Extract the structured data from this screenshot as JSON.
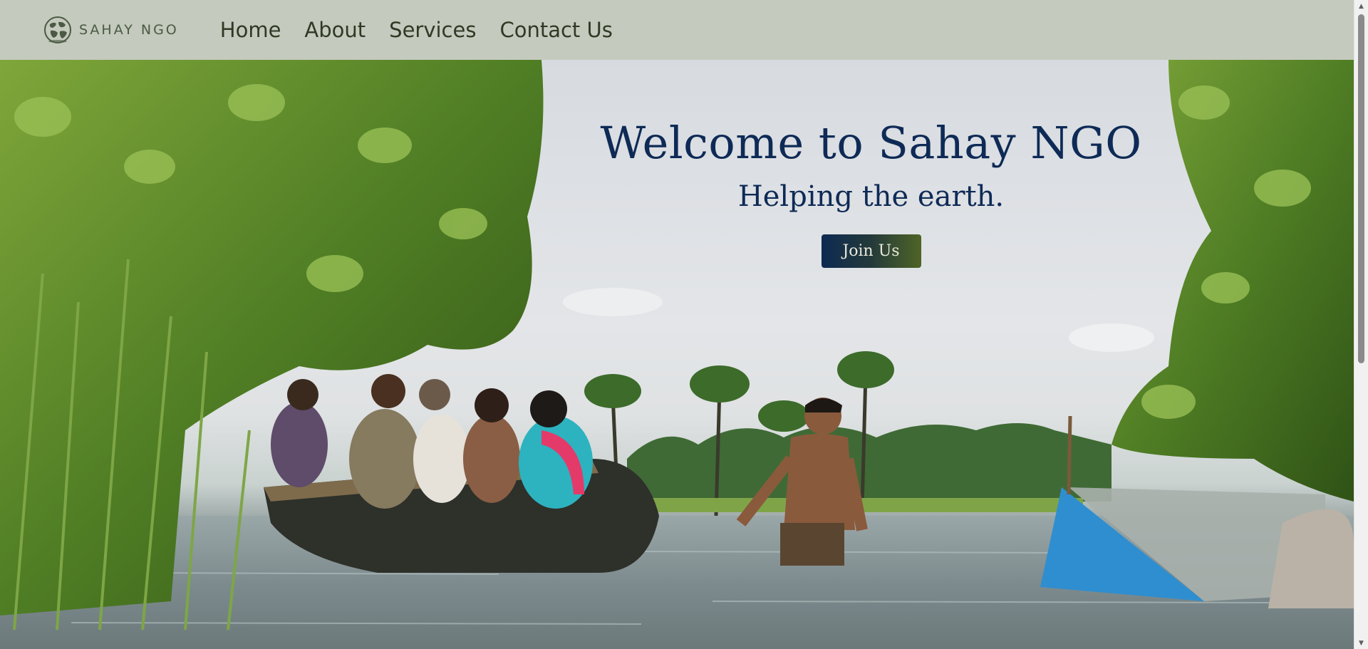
{
  "nav": {
    "brand": "SAHAY NGO",
    "links": [
      "Home",
      "About",
      "Services",
      "Contact Us"
    ]
  },
  "hero": {
    "title": "Welcome to Sahay NGO",
    "subtitle": "Helping the earth.",
    "cta": "Join Us"
  },
  "colors": {
    "navbar_bg": "#c4cabe",
    "title_color": "#0e2a56",
    "button_gradient_start": "#0d2a52",
    "button_gradient_end": "#4f6426"
  },
  "icons": [
    "globe-icon",
    "scroll-up-arrow-icon",
    "scroll-down-arrow-icon"
  ]
}
